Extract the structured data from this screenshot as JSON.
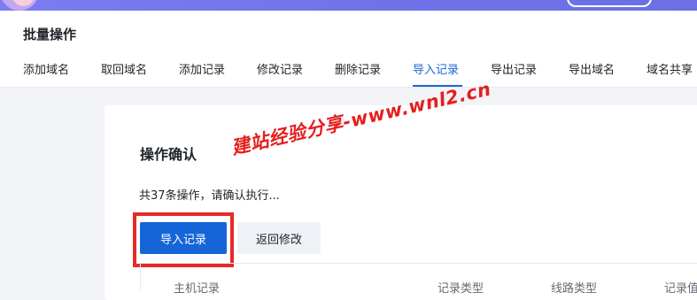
{
  "header": {
    "title": "批量操作",
    "tabs": [
      {
        "label": "添加域名",
        "active": false
      },
      {
        "label": "取回域名",
        "active": false
      },
      {
        "label": "添加记录",
        "active": false
      },
      {
        "label": "修改记录",
        "active": false
      },
      {
        "label": "删除记录",
        "active": false
      },
      {
        "label": "导入记录",
        "active": true
      },
      {
        "label": "导出记录",
        "active": false
      },
      {
        "label": "导出域名",
        "active": false
      },
      {
        "label": "域名共享",
        "active": false
      }
    ]
  },
  "main": {
    "section_title": "操作确认",
    "confirm_text": "共37条操作，请确认执行...",
    "primary_button": "导入记录",
    "secondary_button": "返回修改",
    "table_headers": [
      "主机记录",
      "记录类型",
      "线路类型",
      "记录值"
    ]
  },
  "watermark": "建站经验分享-www.wnl2.cn",
  "colors": {
    "accent": "#1e66d6",
    "primary_button": "#1565d8",
    "highlight": "#e52a2a",
    "topbar": "#6f73ea"
  }
}
